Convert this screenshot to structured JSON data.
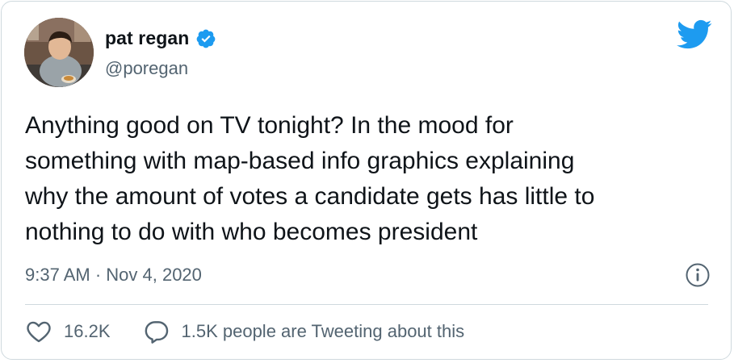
{
  "author": {
    "display_name": "pat regan",
    "handle": "@poregan",
    "verified": true
  },
  "tweet": {
    "text": "Anything good on TV tonight? In the mood for\nsomething with map-based info graphics explaining\nwhy the amount of votes a candidate gets has little to\nnothing to do with who becomes president",
    "timestamp": "9:37 AM · Nov 4, 2020"
  },
  "actions": {
    "like_count": "16.2K",
    "conversation_label": "1.5K people are Tweeting about this"
  },
  "icons": {
    "brand": "twitter-bird-icon",
    "verified": "verified-badge-icon",
    "info": "info-icon",
    "like": "heart-icon",
    "reply": "speech-bubble-icon"
  },
  "colors": {
    "brand_blue": "#1d9bf0",
    "text_primary": "#0f1419",
    "text_secondary": "#536471",
    "border": "#cfd9de"
  }
}
